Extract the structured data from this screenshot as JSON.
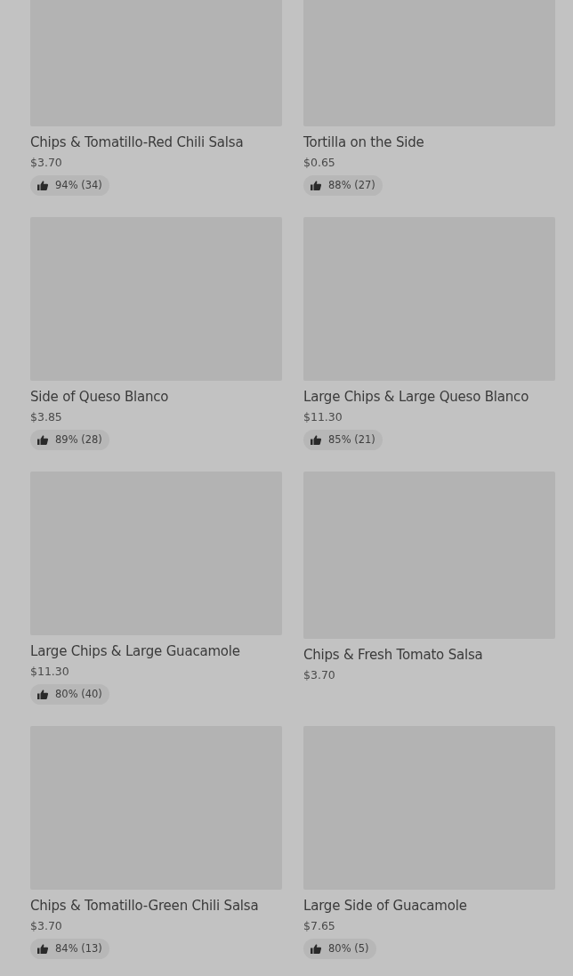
{
  "items": [
    {
      "name": "Chips & Tomatillo-Red Chili Salsa",
      "price": "$3.70",
      "rating": "94% (34)"
    },
    {
      "name": "Tortilla on the Side",
      "price": "$0.65",
      "rating": "88% (27)"
    },
    {
      "name": "Side of Queso Blanco",
      "price": "$3.85",
      "rating": "89% (28)"
    },
    {
      "name": "Large Chips & Large Queso Blanco",
      "price": "$11.30",
      "rating": "85% (21)"
    },
    {
      "name": "Large Chips & Large Guacamole",
      "price": "$11.30",
      "rating": "80% (40)"
    },
    {
      "name": "Chips & Fresh Tomato Salsa",
      "price": "$3.70"
    },
    {
      "name": "Chips & Tomatillo-Green Chili Salsa",
      "price": "$3.70",
      "rating": "84% (13)"
    },
    {
      "name": "Large Side of Guacamole",
      "price": "$7.65",
      "rating": "80% (5)"
    }
  ]
}
